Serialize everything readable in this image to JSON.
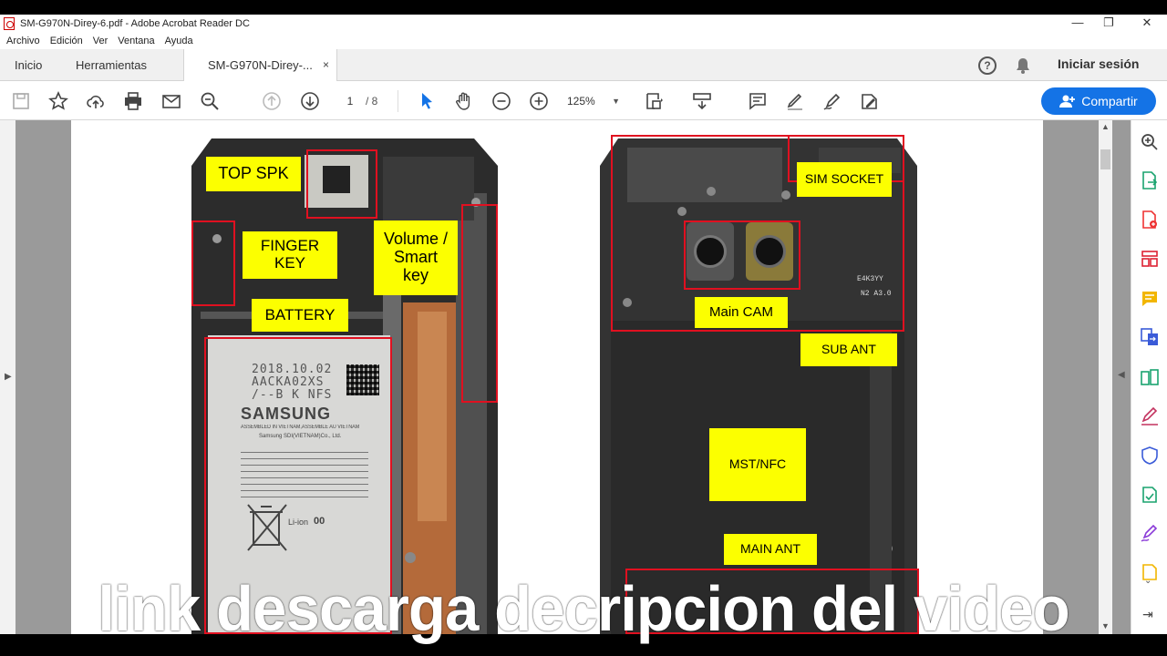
{
  "window": {
    "title": "SM-G970N-Direy-6.pdf - Adobe Acrobat Reader DC",
    "controls": {
      "minimize": "—",
      "maximize": "❐",
      "close": "✕"
    }
  },
  "menu": [
    "Archivo",
    "Edición",
    "Ver",
    "Ventana",
    "Ayuda"
  ],
  "tabs": {
    "home": "Inicio",
    "tools": "Herramientas",
    "document": "SM-G970N-Direy-...",
    "close_glyph": "×"
  },
  "header": {
    "help_glyph": "?",
    "signin": "Iniciar sesión"
  },
  "toolbar": {
    "current_page": "1",
    "total_pages": "/ 8",
    "zoom": "125%",
    "share": "Compartir"
  },
  "document": {
    "left_labels": {
      "top_spk": "TOP SPK",
      "finger_key": "FINGER KEY",
      "volume": "Volume / Smart key",
      "battery": "BATTERY"
    },
    "right_labels": {
      "sim_socket": "SIM SOCKET",
      "main_cam": "Main CAM",
      "sub_ant": "SUB ANT",
      "mst_nfc": "MST/NFC",
      "main_ant": "MAIN ANT"
    },
    "battery_print": {
      "date": "2018.10.02",
      "code1": "AACKA02XS",
      "code2": "/--B K NFS",
      "brand": "SAMSUNG",
      "made": "ASSEMBLED IN VIETNAM,ASSEMBLE AU VIETNAM",
      "vendor": "Samsung SDI(VIETNAM)Co., Ltd.",
      "liion": "Li-ion",
      "liion_num": "00"
    },
    "board_marks": {
      "chip": "E4K3YY",
      "code": "N2 A3.0"
    }
  },
  "overlay_text": "link  descarga decripcion del video",
  "colors": {
    "accent": "#1473e6",
    "label_yellow": "#fcff00",
    "box_red": "#e01020"
  }
}
